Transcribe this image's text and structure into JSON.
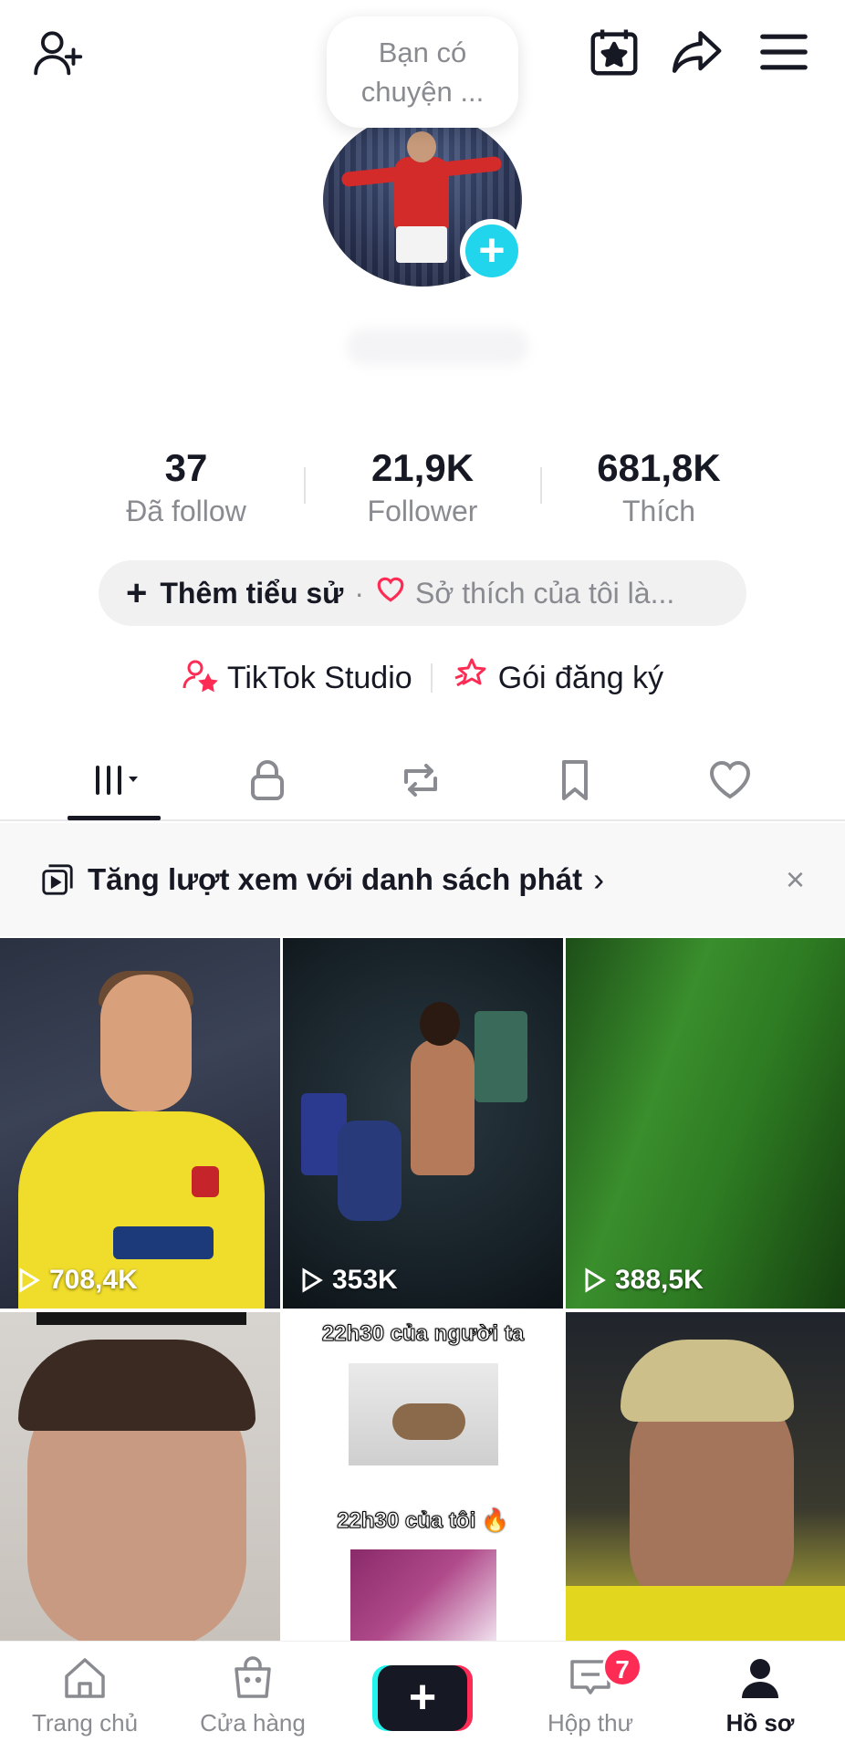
{
  "header": {
    "note_bubble": "Bạn có chuyện ...",
    "icons": [
      "add-friend-icon",
      "calendar-star-icon",
      "share-icon",
      "menu-icon"
    ]
  },
  "stats": [
    {
      "value": "37",
      "label": "Đã follow"
    },
    {
      "value": "21,9K",
      "label": "Follower"
    },
    {
      "value": "681,8K",
      "label": "Thích"
    }
  ],
  "bio": {
    "plus": "+",
    "add_label": "Thêm tiểu sử",
    "dot": "·",
    "hobby": "Sở thích của tôi là..."
  },
  "studio": {
    "tiktok_studio": "TikTok Studio",
    "subscription": "Gói đăng ký"
  },
  "tabs": [
    "videos-grid-tab",
    "private-tab",
    "reposts-tab",
    "favorites-tab",
    "liked-tab"
  ],
  "banner": {
    "text": "Tăng lượt xem với danh sách phát",
    "chevron": "›",
    "close": "×"
  },
  "videos": [
    {
      "views": "708,4K"
    },
    {
      "views": "353K"
    },
    {
      "views": "388,5K"
    },
    {
      "views": ""
    },
    {
      "views": ""
    },
    {
      "views": ""
    }
  ],
  "meme": {
    "line1": "22h30 của người ta",
    "line2": "22h30 của tôi 🔥"
  },
  "nav": {
    "home": "Trang chủ",
    "shop": "Cửa hàng",
    "create": "+",
    "inbox": "Hộp thư",
    "inbox_badge": "7",
    "profile": "Hồ sơ"
  },
  "colors": {
    "accent": "#fe2c55",
    "cyan": "#25f4ee",
    "text": "#161823",
    "muted": "#8a8b91"
  }
}
